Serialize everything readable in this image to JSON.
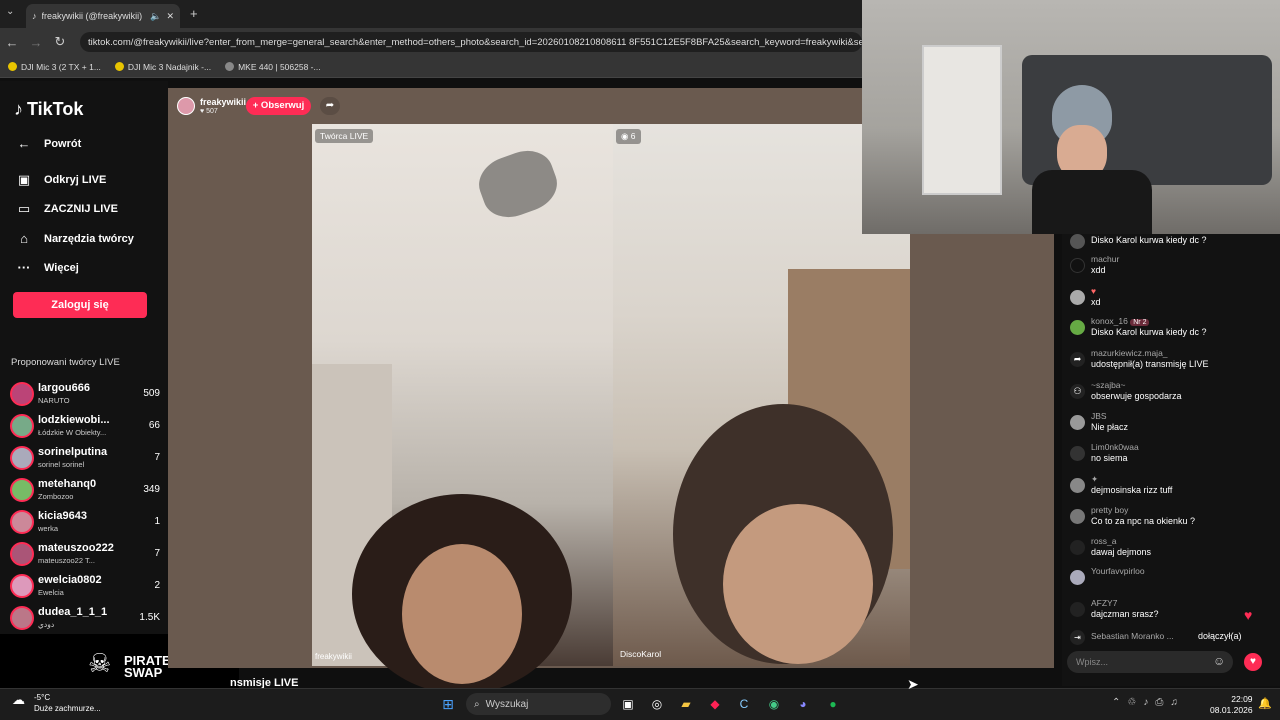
{
  "browser": {
    "tab_title": "freakywikii (@freakywikii) p",
    "url": "tiktok.com/@freakywikii/live?enter_from_merge=general_search&enter_method=others_photo&search_id=20260108210808611 8F551C12E5F8BFA25&search_keyword=freakywiki&searc",
    "bookmarks": [
      "DJI Mic 3 (2 TX + 1...",
      "DJI Mic 3 Nadajnik -...",
      "MKE 440 | 506258 -..."
    ]
  },
  "sidebar": {
    "logo": "TikTok",
    "back": "Powrót",
    "items": [
      "Odkryj LIVE",
      "ZACZNIJ LIVE",
      "Narzędzia twórcy",
      "Więcej"
    ],
    "login": "Zaloguj się",
    "suggested_title": "Proponowani twórcy LIVE",
    "creators": [
      {
        "name": "largou666",
        "sub": "NARUTO",
        "count": "509"
      },
      {
        "name": "lodzkiewobi...",
        "sub": "Łódzkie W Obiekty...",
        "count": "66"
      },
      {
        "name": "sorinelputina",
        "sub": "sorinel sorinel",
        "count": "7"
      },
      {
        "name": "metehanq0",
        "sub": "Zombozoo",
        "count": "349"
      },
      {
        "name": "kicia9643",
        "sub": "werka",
        "count": "1"
      },
      {
        "name": "mateuszoo222",
        "sub": "mateuszoo22 T...",
        "count": "7"
      },
      {
        "name": "ewelcia0802",
        "sub": "Ewelcia",
        "count": "2"
      },
      {
        "name": "dudea_1_1_1",
        "sub": "دودي",
        "count": "1.5K"
      }
    ],
    "pirate": "PIRATE SWAP",
    "bottom_text": "nsmisje LIVE"
  },
  "live": {
    "host": "freakywikii",
    "likes": "507",
    "follow": "+ Obserwuj",
    "creator_tag": "Twórca LIVE",
    "viewer_count": "6",
    "left_name": "freakywikii",
    "right_name": "DiscoKarol"
  },
  "chat": {
    "messages": [
      {
        "user": "",
        "text": "Disko Karol kurwa kiedy dc ?"
      },
      {
        "user": "machur",
        "text": "xdd"
      },
      {
        "user": "",
        "text": "xd"
      },
      {
        "user": "konox_16",
        "text": "Disko Karol kurwa kiedy dc ?"
      },
      {
        "user": "mazurkiewicz.maja_",
        "text": "udostępnił(a) transmisję LIVE"
      },
      {
        "user": "~szajba~",
        "text": "obserwuje gospodarza"
      },
      {
        "user": "JBS",
        "text": "Nie płacz"
      },
      {
        "user": "Lim0nk0waa",
        "text": "no siema"
      },
      {
        "user": "",
        "text": "dejmosinska rizz tuff"
      },
      {
        "user": "pretty boy",
        "text": "Co to za npc na okienku ?"
      },
      {
        "user": "ross_a",
        "text": "dawaj dejmons"
      },
      {
        "user": "Yourfavvpirloo",
        "text": ""
      },
      {
        "user": "AFZY7",
        "text": "dajczman srasz?"
      },
      {
        "user": "Sebastian Moranko ...",
        "text": "dołączył(a)"
      }
    ],
    "badge_nr": "Nr 2",
    "placeholder": "Wpisz..."
  },
  "taskbar": {
    "weather_temp": "-5°C",
    "weather_desc": "Duże zachmurze...",
    "search": "Wyszukaj",
    "time": "22:09",
    "date": "08.01.2026"
  }
}
